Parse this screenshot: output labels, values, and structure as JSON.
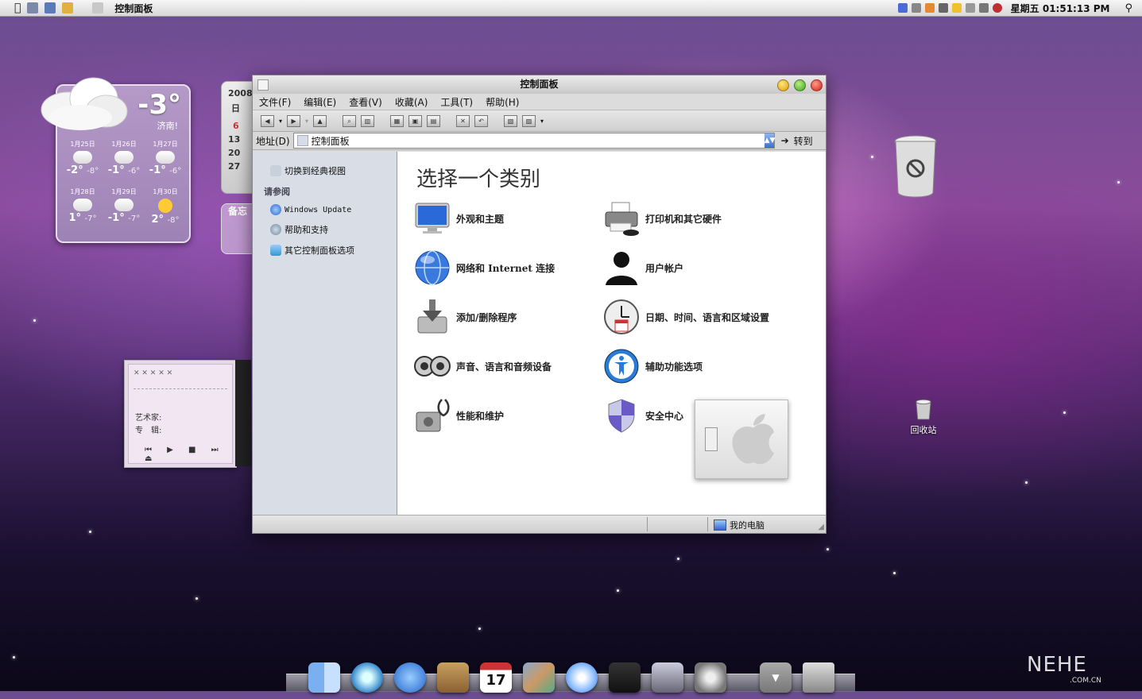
{
  "menubar": {
    "title": "控制面板",
    "clock": "星期五 01:51:13 PM"
  },
  "weather": {
    "temp": "-3°",
    "city": "济南!",
    "forecast": [
      {
        "date": "1月25日",
        "high": "-2°",
        "low": "-8°"
      },
      {
        "date": "1月26日",
        "high": "-1°",
        "low": "-6°"
      },
      {
        "date": "1月27日",
        "high": "-1°",
        "low": "-6°"
      },
      {
        "date": "1月28日",
        "high": "1°",
        "low": "-7°"
      },
      {
        "date": "1月29日",
        "high": "-1°",
        "low": "-7°"
      },
      {
        "date": "1月30日",
        "high": "2°",
        "low": "-8°"
      }
    ]
  },
  "calendar": {
    "year": "2008",
    "weekday": "日",
    "rows": [
      "6",
      "13",
      "20",
      "27"
    ]
  },
  "memo": {
    "label": "备忘"
  },
  "player": {
    "artist_label": "艺术家:",
    "album_label": "专　辑:",
    "controls": "⏮ ▶ ■ ⏭ ⏏"
  },
  "window": {
    "title": "控制面板",
    "menu": [
      "文件(F)",
      "编辑(E)",
      "查看(V)",
      "收藏(A)",
      "工具(T)",
      "帮助(H)"
    ],
    "address_label": "地址(D)",
    "address_value": "控制面板",
    "go_label": "转到",
    "sidebar": {
      "switch_view": "切换到经典视图",
      "see_also": "请参阅",
      "links": [
        "Windows Update",
        "帮助和支持",
        "其它控制面板选项"
      ]
    },
    "content_title": "选择一个类别",
    "categories": [
      {
        "label": "外观和主题"
      },
      {
        "label": "打印机和其它硬件"
      },
      {
        "label": "网络和 Internet 连接"
      },
      {
        "label": "用户帐户"
      },
      {
        "label": "添加/删除程序"
      },
      {
        "label": "日期、时间、语言和区域设置"
      },
      {
        "label": "声音、语言和音频设备"
      },
      {
        "label": "辅助功能选项"
      },
      {
        "label": "性能和维护"
      },
      {
        "label": "安全中心"
      }
    ],
    "calendar_day": "17",
    "status": "我的电脑"
  },
  "desktop": {
    "recycle_label": "回收站"
  },
  "watermark": {
    "main": "NEHE",
    "sub": ".COM.CN"
  }
}
